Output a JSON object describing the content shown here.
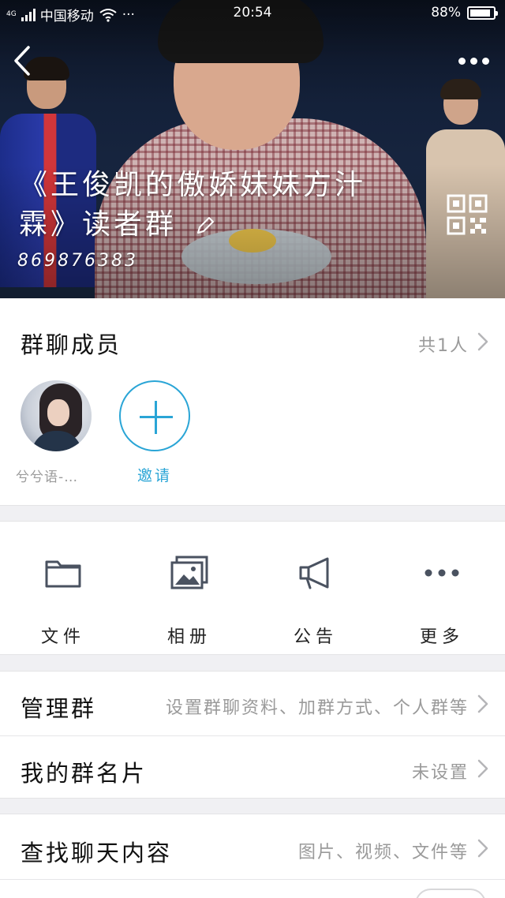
{
  "status_bar": {
    "network": "4G",
    "carrier": "中国移动",
    "more": "···",
    "time": "20:54",
    "battery": "88%",
    "battery_level": 0.88
  },
  "header": {
    "group_name": "《王俊凯的傲娇妹妹方汁霖》读者群",
    "group_id": "869876383"
  },
  "members": {
    "title": "群聊成员",
    "count": "共1人",
    "list": [
      {
        "name": "兮兮语-…"
      }
    ],
    "invite_label": "邀请"
  },
  "actions": [
    {
      "label": "文件",
      "icon": "folder-icon"
    },
    {
      "label": "相册",
      "icon": "album-icon"
    },
    {
      "label": "公告",
      "icon": "megaphone-icon"
    },
    {
      "label": "更多",
      "icon": "more-dots-icon"
    }
  ],
  "settings": {
    "manage": {
      "title": "管理群",
      "value": "设置群聊资料、加群方式、个人群等"
    },
    "card": {
      "title": "我的群名片",
      "value": "未设置"
    }
  },
  "search_chat": {
    "title": "查找聊天内容",
    "value": "图片、视频、文件等"
  },
  "colors": {
    "accent": "#2aa5d6",
    "muted_text": "#9a9a9a",
    "icon_gray": "#4a5260",
    "background": "#f0f0f3"
  }
}
